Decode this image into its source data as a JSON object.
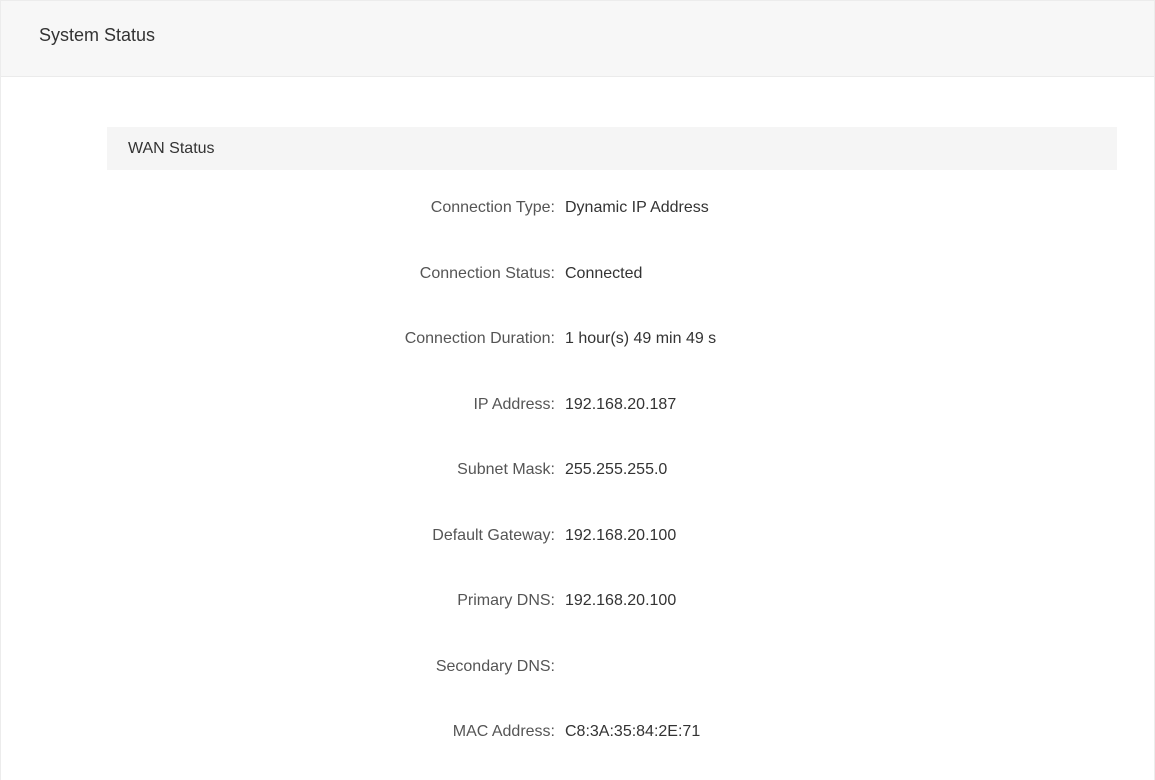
{
  "page": {
    "title": "System Status"
  },
  "wan": {
    "title": "WAN Status",
    "rows": [
      {
        "label": "Connection Type:",
        "value": "Dynamic IP Address"
      },
      {
        "label": "Connection Status:",
        "value": "Connected"
      },
      {
        "label": "Connection Duration:",
        "value": "1 hour(s) 49 min 49 s"
      },
      {
        "label": "IP Address:",
        "value": "192.168.20.187"
      },
      {
        "label": "Subnet Mask:",
        "value": "255.255.255.0"
      },
      {
        "label": "Default Gateway:",
        "value": "192.168.20.100"
      },
      {
        "label": "Primary DNS:",
        "value": "192.168.20.100"
      },
      {
        "label": "Secondary DNS:",
        "value": ""
      },
      {
        "label": "MAC Address:",
        "value": "C8:3A:35:84:2E:71"
      }
    ]
  }
}
